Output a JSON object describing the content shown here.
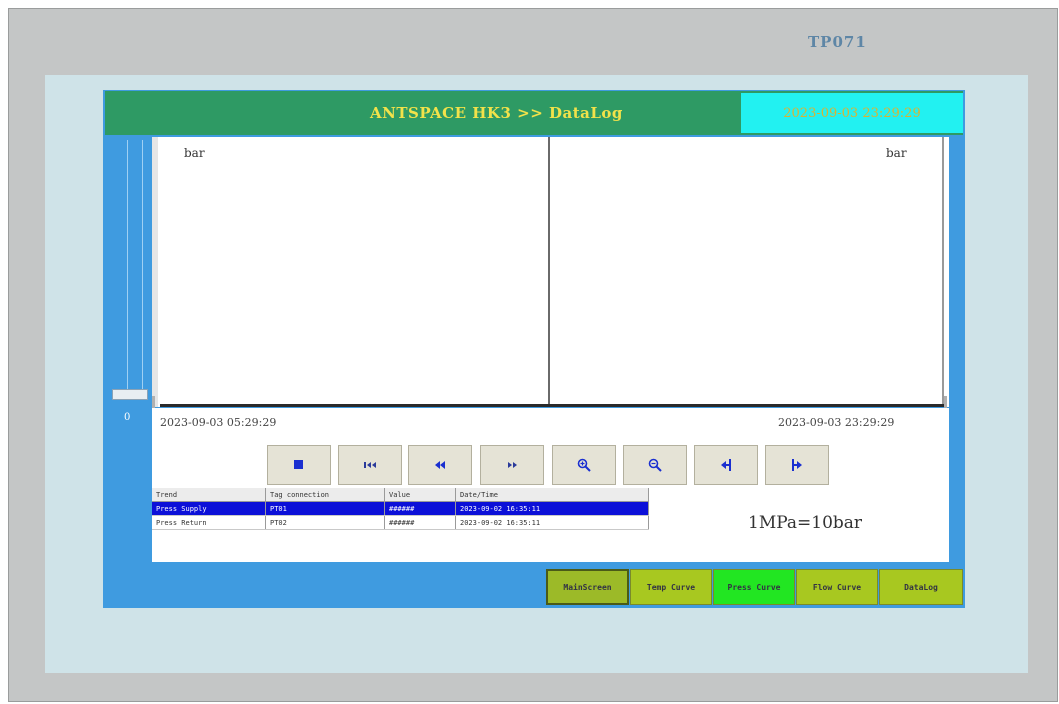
{
  "device": {
    "model": "TP071"
  },
  "header": {
    "title": "ANTSPACE HK3 >> DataLog",
    "datetime": "2023-09-03 23:29:29"
  },
  "slider": {
    "value": "0"
  },
  "chart": {
    "left_unit": "bar",
    "right_unit": "bar",
    "time_start": "2023-09-03 05:29:29",
    "time_end": "2023-09-03 23:29:29"
  },
  "toolbar": {
    "buttons": [
      {
        "name": "stop-button",
        "icon": "stop-icon"
      },
      {
        "name": "first-page-button",
        "icon": "skip-back-icon"
      },
      {
        "name": "rewind-button",
        "icon": "rewind-icon"
      },
      {
        "name": "forward-button",
        "icon": "forward-icon"
      },
      {
        "name": "zoom-in-button",
        "icon": "zoom-in-icon"
      },
      {
        "name": "zoom-out-button",
        "icon": "zoom-out-icon"
      },
      {
        "name": "ruler-left-button",
        "icon": "ruler-left-icon"
      },
      {
        "name": "ruler-right-button",
        "icon": "ruler-right-icon"
      }
    ]
  },
  "table": {
    "headers": [
      "Trend",
      "Tag connection",
      "Value",
      "Date/Time"
    ],
    "rows": [
      [
        "Press Supply",
        "PT01",
        "######",
        "2023-09-02 16:35:11"
      ],
      [
        "Press Return",
        "PT02",
        "######",
        "2023-09-02 16:35:11"
      ]
    ],
    "selected_row": 0
  },
  "note": "1MPa=10bar",
  "nav": [
    {
      "label": "MainScreen",
      "color": "#9cba28"
    },
    {
      "label": "Temp Curve",
      "color": "#a8c820"
    },
    {
      "label": "Press Curve",
      "color": "#22e622"
    },
    {
      "label": "Flow Curve",
      "color": "#a8c820"
    },
    {
      "label": "DataLog",
      "color": "#a8c820"
    }
  ],
  "colors": {
    "titlebar": "#2e9a64",
    "title_text": "#f2e24a",
    "clock_bg": "#22f1f1",
    "panel": "#3f9be0",
    "selected_row": "#0c10d8"
  }
}
